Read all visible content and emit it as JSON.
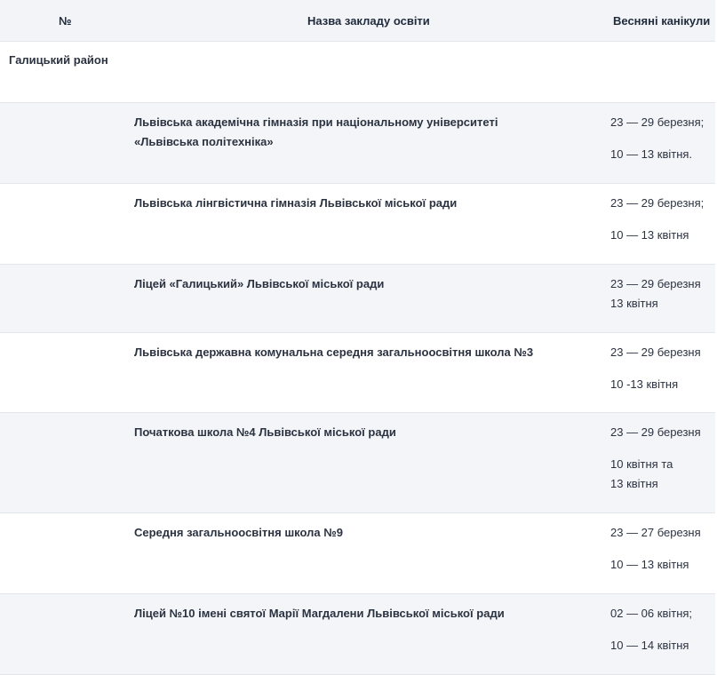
{
  "header": {
    "col_number": "№",
    "col_name": "Назва закладу освіти",
    "col_holidays": "Весняні канікули"
  },
  "district": "Галицький район",
  "rows": [
    {
      "name": "Львівська академічна гімназія при національному університеті «Львівська політехніка»",
      "holidays": [
        "23 — 29 березня;",
        "10 — 13 квітня."
      ]
    },
    {
      "name": "Львівська лінгвістична гімназія Львівської міської ради",
      "holidays": [
        "23 — 29 березня;",
        "10 — 13 квітня"
      ]
    },
    {
      "name": "Ліцей «Галицький» Львівської міської ради",
      "holidays": [
        "23 — 29 березня",
        "13 квітня"
      ]
    },
    {
      "name": "Львівська державна комунальна середня загальноосвітня школа №3",
      "holidays": [
        "23 — 29 березня",
        "10 -13 квітня"
      ]
    },
    {
      "name": "Початкова школа №4 Львівської міської ради",
      "holidays": [
        "23 — 29 березня",
        "10 квітня та",
        "13 квітня"
      ]
    },
    {
      "name": "Середня загальноосвітня школа №9",
      "holidays": [
        "23 — 27 березня",
        "10 — 13 квітня"
      ]
    },
    {
      "name": "Ліцей №10 імені святої Марії Магдалени Львівської міської ради",
      "holidays": [
        "02 — 06 квітня;",
        "10 — 14 квітня"
      ]
    }
  ]
}
